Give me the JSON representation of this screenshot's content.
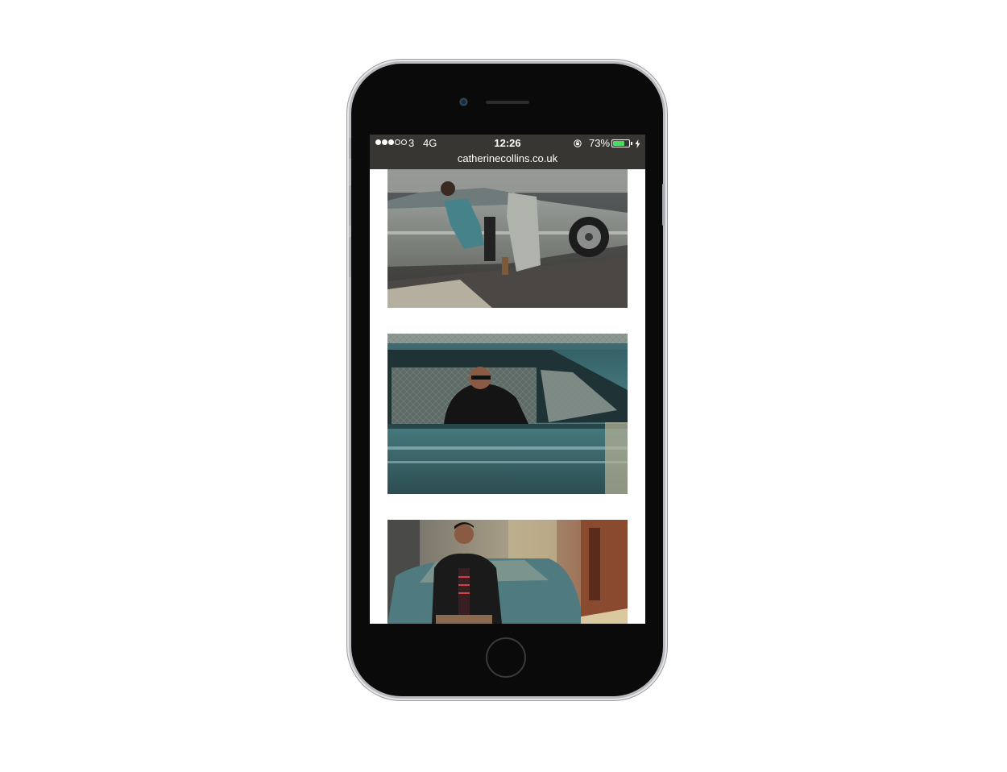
{
  "status_bar": {
    "signal_bars_filled": 3,
    "signal_bars_total": 5,
    "carrier": "3",
    "network": "4G",
    "time": "12:26",
    "battery_percent": "73%",
    "battery_level": 0.73,
    "battery_color": "#4cd964",
    "icons": [
      "orientation-lock-icon",
      "battery-icon",
      "charging-bolt-icon"
    ]
  },
  "browser": {
    "url": "catherinecollins.co.uk"
  },
  "gallery": {
    "photos": [
      {
        "subject": "couple-in-silver-convertible"
      },
      {
        "subject": "man-in-car-window"
      },
      {
        "subject": "man-leaning-on-car-street"
      }
    ]
  }
}
